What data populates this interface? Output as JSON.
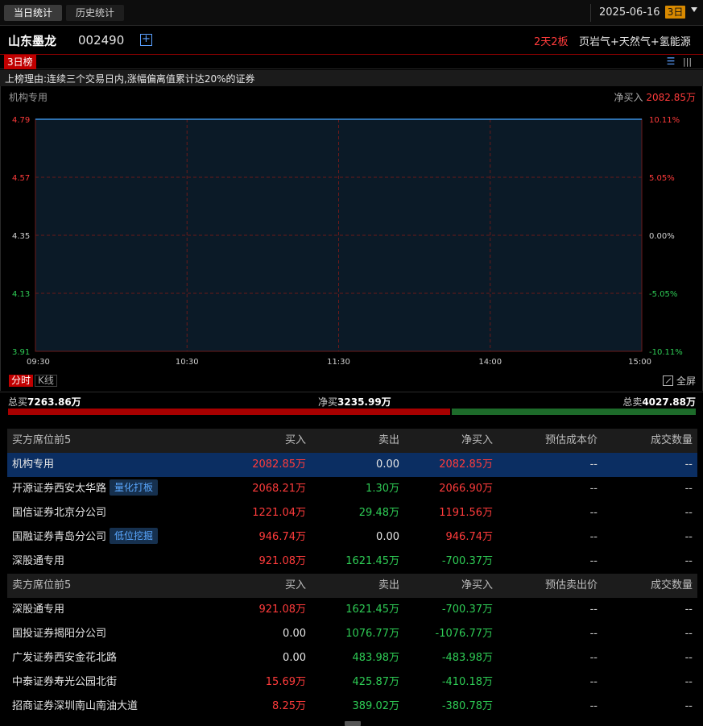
{
  "tabs": {
    "today": "当日统计",
    "history": "历史统计"
  },
  "date": {
    "value": "2025-06-16",
    "period_badge": "3日"
  },
  "stock": {
    "name": "山东墨龙",
    "code": "002490",
    "limit_tag": "2天2板",
    "concepts": "页岩气+天然气+氢能源"
  },
  "rank_tab": "3日榜",
  "reason": "上榜理由:连续三个交易日内,涨幅偏离值累计达20%的证券",
  "chart_panel": {
    "seat_label": "机构专用",
    "netbuy_label": "净买入",
    "netbuy_value": "2082.85万"
  },
  "chart_data": {
    "type": "line",
    "price_ticks": [
      "4.79",
      "4.57",
      "4.35",
      "4.13",
      "3.91"
    ],
    "pct_ticks": [
      "10.11%",
      "5.05%",
      "0.00%",
      "-5.05%",
      "-10.11%"
    ],
    "time_ticks": [
      "09:30",
      "10:30",
      "11:30",
      "14:00",
      "15:00"
    ],
    "ylim": [
      3.91,
      4.79
    ],
    "series": [
      {
        "x": [
          "09:30",
          "15:00"
        ],
        "values": [
          4.79,
          4.79
        ]
      }
    ],
    "grid": true,
    "colors": {
      "line": "#3a8fe0",
      "area": "#0b1a27",
      "grid": "#6b1a1a"
    }
  },
  "chart_tabs": {
    "fenshi": "分时",
    "kline": "K线",
    "fullscreen": "全屏"
  },
  "summary": {
    "total_buy_label": "总买",
    "total_buy": "7263.86万",
    "net_buy_label": "净买",
    "net_buy": "3235.99万",
    "total_sell_label": "总卖",
    "total_sell": "4027.88万",
    "buy_fraction": 0.6433
  },
  "buy_table": {
    "headers": [
      "买方席位前5",
      "买入",
      "卖出",
      "净买入",
      "预估成本价",
      "成交数量"
    ],
    "rows": [
      {
        "name": "机构专用",
        "tag": "",
        "buy": "2082.85万",
        "sell": "0.00",
        "net": "2082.85万",
        "cost": "--",
        "vol": "--"
      },
      {
        "name": "开源证券西安太华路",
        "tag": "量化打板",
        "buy": "2068.21万",
        "sell": "1.30万",
        "net": "2066.90万",
        "cost": "--",
        "vol": "--"
      },
      {
        "name": "国信证券北京分公司",
        "tag": "",
        "buy": "1221.04万",
        "sell": "29.48万",
        "net": "1191.56万",
        "cost": "--",
        "vol": "--"
      },
      {
        "name": "国融证券青岛分公司",
        "tag": "低位挖掘",
        "buy": "946.74万",
        "sell": "0.00",
        "net": "946.74万",
        "cost": "--",
        "vol": "--"
      },
      {
        "name": "深股通专用",
        "tag": "",
        "buy": "921.08万",
        "sell": "1621.45万",
        "net": "-700.37万",
        "cost": "--",
        "vol": "--"
      }
    ]
  },
  "sell_table": {
    "headers": [
      "卖方席位前5",
      "买入",
      "卖出",
      "净买入",
      "预估卖出价",
      "成交数量"
    ],
    "rows": [
      {
        "name": "深股通专用",
        "buy": "921.08万",
        "sell": "1621.45万",
        "net": "-700.37万",
        "cost": "--",
        "vol": "--"
      },
      {
        "name": "国投证券揭阳分公司",
        "buy": "0.00",
        "sell": "1076.77万",
        "net": "-1076.77万",
        "cost": "--",
        "vol": "--"
      },
      {
        "name": "广发证券西安金花北路",
        "buy": "0.00",
        "sell": "483.98万",
        "net": "-483.98万",
        "cost": "--",
        "vol": "--"
      },
      {
        "name": "中泰证券寿光公园北街",
        "buy": "15.69万",
        "sell": "425.87万",
        "net": "-410.18万",
        "cost": "--",
        "vol": "--"
      },
      {
        "name": "招商证券深圳南山南油大道",
        "buy": "8.25万",
        "sell": "389.02万",
        "net": "-380.78万",
        "cost": "--",
        "vol": "--"
      }
    ]
  }
}
